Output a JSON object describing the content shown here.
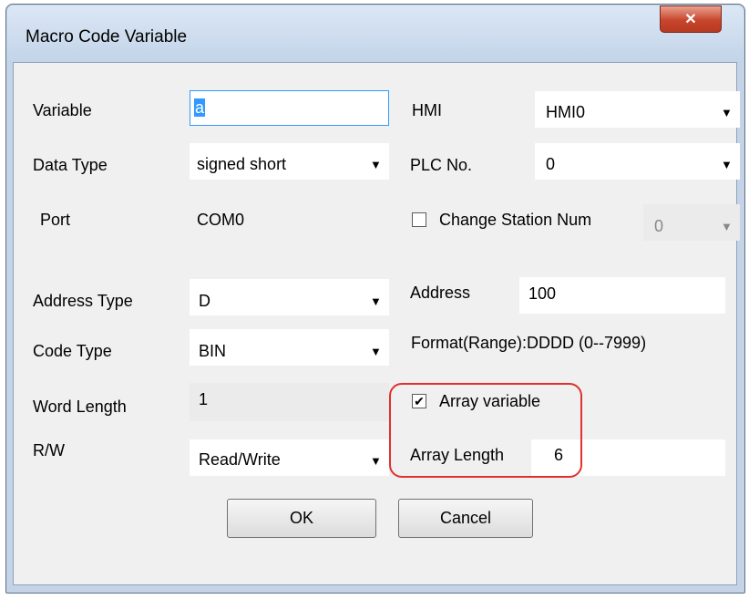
{
  "window": {
    "title": "Macro Code Variable",
    "close_glyph": "✕"
  },
  "fields": {
    "variable": {
      "label": "Variable",
      "value": "a"
    },
    "hmi": {
      "label": "HMI",
      "value": "HMI0"
    },
    "data_type": {
      "label": "Data Type",
      "value": "signed short"
    },
    "plc_no": {
      "label": "PLC No.",
      "value": "0"
    },
    "port": {
      "label": "Port",
      "value": "COM0"
    },
    "change_station": {
      "label": "Change Station Num",
      "checked": false,
      "value": "0"
    },
    "address_type": {
      "label": "Address Type",
      "value": "D"
    },
    "address": {
      "label": "Address",
      "value": "100"
    },
    "format_range": "Format(Range):DDDD (0--7999)",
    "code_type": {
      "label": "Code Type",
      "value": "BIN"
    },
    "word_length": {
      "label": "Word Length",
      "value": "1"
    },
    "array_variable": {
      "label": "Array variable",
      "checked": true,
      "check_glyph": "✔"
    },
    "rw": {
      "label": "R/W",
      "value": "Read/Write"
    },
    "array_length": {
      "label": "Array Length",
      "value": "6"
    }
  },
  "buttons": {
    "ok": "OK",
    "cancel": "Cancel"
  },
  "colors": {
    "highlight": "#e0312f",
    "client_bg": "#f0f0f0",
    "selection": "#3399ff"
  },
  "icons": {
    "dropdown": "▼"
  }
}
